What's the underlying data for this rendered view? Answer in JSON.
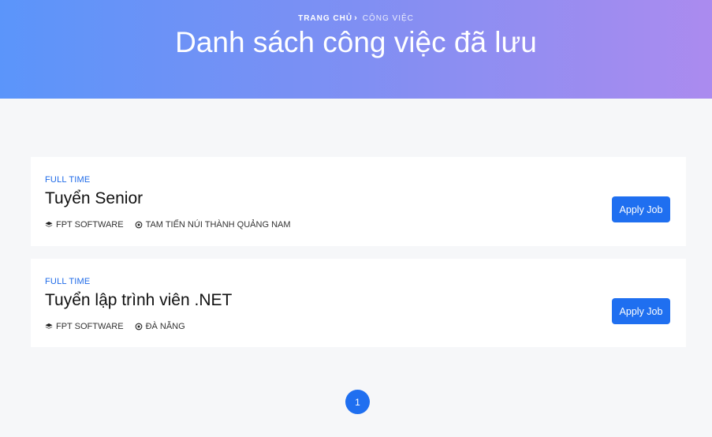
{
  "header": {
    "breadcrumb": {
      "home": "Trang chủ",
      "separator": "›",
      "current": "Công việc"
    },
    "title": "Danh sách công việc đã lưu"
  },
  "jobs": [
    {
      "type": "FULL TIME",
      "title": "Tuyển Senior",
      "company": "FPT SOFTWARE",
      "location": "TAM TIẾN NÚI THÀNH QUẢNG NAM",
      "apply_label": "Apply Job"
    },
    {
      "type": "FULL TIME",
      "title": "Tuyển lập trình viên .NET",
      "company": "FPT SOFTWARE",
      "location": "ĐÀ NẴNG",
      "apply_label": "Apply Job"
    }
  ],
  "pagination": {
    "current_page": "1"
  },
  "icons": {
    "company": "layers-icon",
    "location": "location-target-icon"
  },
  "colors": {
    "accent": "#1f6ff0",
    "hero_start": "#5b95fa",
    "hero_end": "#ab8bef",
    "job_type": "#1e6ae8"
  }
}
